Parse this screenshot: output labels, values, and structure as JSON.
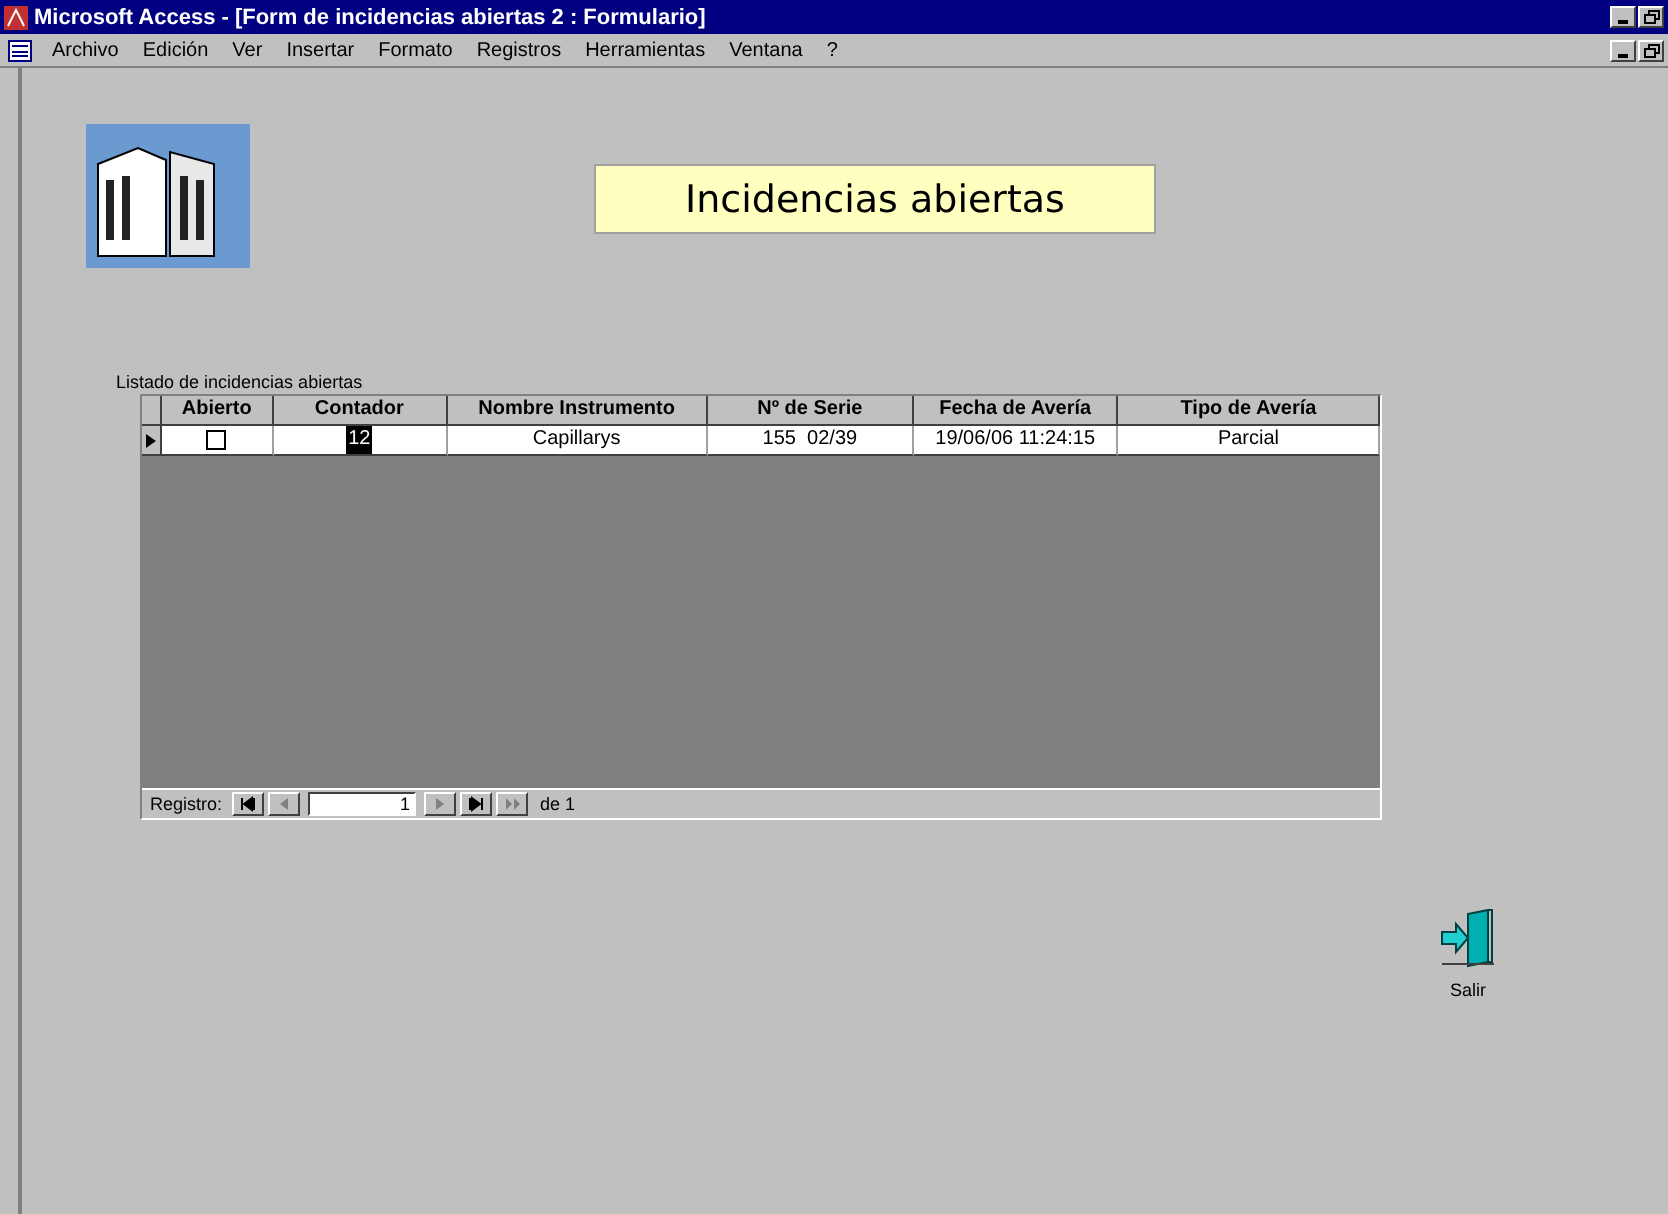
{
  "window": {
    "title": "Microsoft Access - [Form de incidencias abiertas 2 : Formulario]"
  },
  "menu": [
    "Archivo",
    "Edición",
    "Ver",
    "Insertar",
    "Formato",
    "Registros",
    "Herramientas",
    "Ventana",
    "?"
  ],
  "form": {
    "title": "Incidencias abiertas",
    "subform_label": "Listado de incidencias abiertas"
  },
  "table": {
    "columns": [
      "Abierto",
      "Contador",
      "Nombre Instrumento",
      "Nº de Serie",
      "Fecha de Avería",
      "Tipo de Avería"
    ],
    "rows": [
      {
        "current": true,
        "abierto": false,
        "contador": "12",
        "nombre": "Capillarys",
        "serie": "155  02/39",
        "fecha": "19/06/06 11:24:15",
        "tipo": "Parcial"
      }
    ]
  },
  "navigator": {
    "label": "Registro:",
    "value": "1",
    "of": "de 1",
    "buttons": [
      {
        "kind": "first",
        "disabled": false
      },
      {
        "kind": "prev",
        "disabled": true
      },
      {
        "kind": "next",
        "disabled": true
      },
      {
        "kind": "last",
        "disabled": false
      },
      {
        "kind": "new",
        "disabled": true
      }
    ]
  },
  "exit_button": {
    "label": "Salir"
  }
}
